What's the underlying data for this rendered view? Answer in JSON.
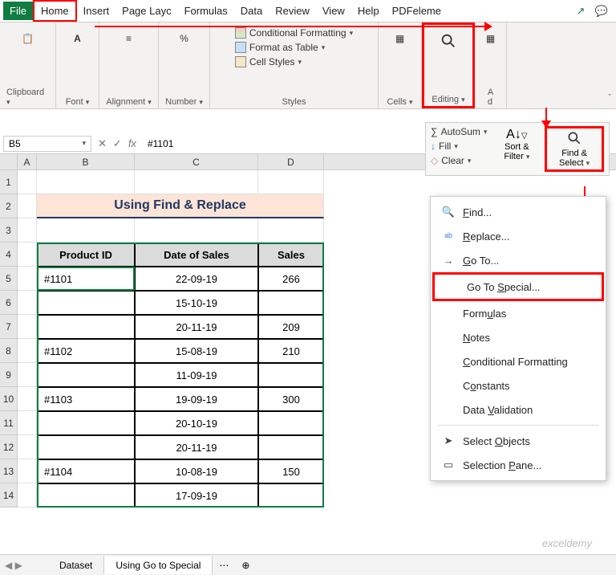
{
  "tabs": {
    "file": "File",
    "home": "Home",
    "insert": "Insert",
    "pagelayout": "Page Layc",
    "formulas": "Formulas",
    "data": "Data",
    "review": "Review",
    "view": "View",
    "help": "Help",
    "pdfelement": "PDFeleme"
  },
  "ribbon": {
    "clipboard": "Clipboard",
    "font": "Font",
    "alignment": "Alignment",
    "number": "Number",
    "styles": "Styles",
    "cells": "Cells",
    "editing": "Editing",
    "addins": "A",
    "addins2": "d",
    "conditional_formatting": "Conditional Formatting",
    "format_as_table": "Format as Table",
    "cell_styles": "Cell Styles"
  },
  "namebox": "B5",
  "formula": "#1101",
  "columns": {
    "a": "A",
    "b": "B",
    "c": "C",
    "d": "D"
  },
  "title": "Using Find & Replace",
  "headers": {
    "product_id": "Product ID",
    "date_of_sales": "Date of Sales",
    "sales": "Sales"
  },
  "rows": [
    {
      "pid": "#1101",
      "date": "22-09-19",
      "sales": "266"
    },
    {
      "pid": "",
      "date": "15-10-19",
      "sales": ""
    },
    {
      "pid": "",
      "date": "20-11-19",
      "sales": "209"
    },
    {
      "pid": "#1102",
      "date": "15-08-19",
      "sales": "210"
    },
    {
      "pid": "",
      "date": "11-09-19",
      "sales": ""
    },
    {
      "pid": "#1103",
      "date": "19-09-19",
      "sales": "300"
    },
    {
      "pid": "",
      "date": "20-10-19",
      "sales": ""
    },
    {
      "pid": "",
      "date": "20-11-19",
      "sales": ""
    },
    {
      "pid": "#1104",
      "date": "10-08-19",
      "sales": "150"
    },
    {
      "pid": "",
      "date": "17-09-19",
      "sales": ""
    }
  ],
  "edit_panel": {
    "autosum": "AutoSum",
    "fill": "Fill",
    "clear": "Clear",
    "sort_filter": "Sort & Filter",
    "find_select": "Find & Select"
  },
  "ctx": {
    "find": "Find...",
    "replace": "Replace...",
    "goto": "Go To...",
    "goto_special": "Go To Special...",
    "formulas": "Formulas",
    "notes": "Notes",
    "conditional_formatting": "Conditional Formatting",
    "constants": "Constants",
    "data_validation": "Data Validation",
    "select_objects": "Select Objects",
    "selection_pane": "Selection Pane..."
  },
  "sheet_tabs": {
    "dataset": "Dataset",
    "using_go_to_special": "Using Go to Special"
  },
  "watermark": "exceldemy"
}
